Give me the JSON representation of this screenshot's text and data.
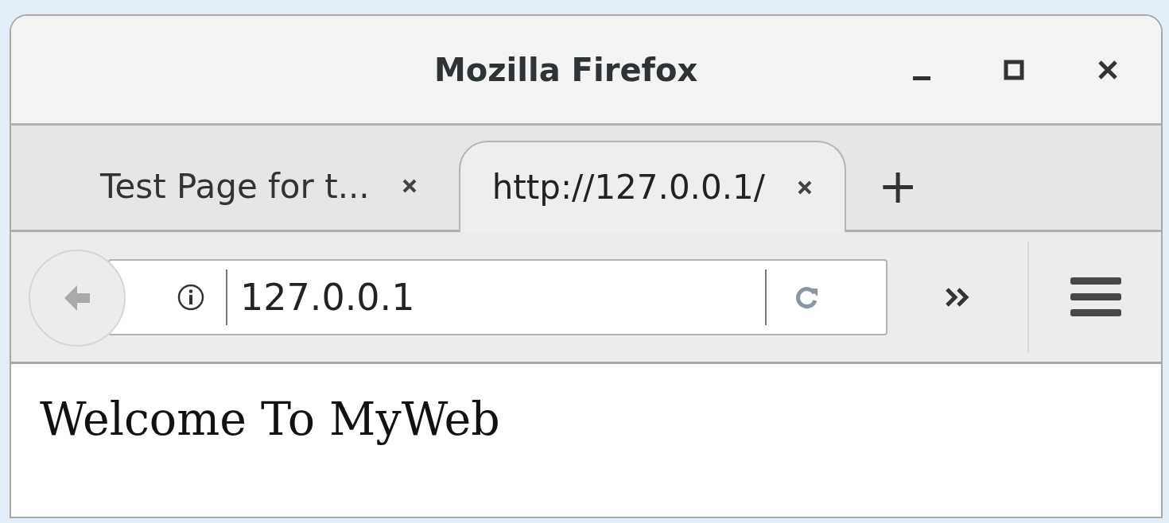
{
  "window": {
    "title": "Mozilla Firefox"
  },
  "tabs": [
    {
      "label": "Test Page for t...",
      "selected": false
    },
    {
      "label": "http://127.0.0.1/",
      "selected": true
    }
  ],
  "new_tab": "+",
  "address_bar": {
    "value": "127.0.0.1"
  },
  "page": {
    "text": "Welcome To MyWeb"
  }
}
